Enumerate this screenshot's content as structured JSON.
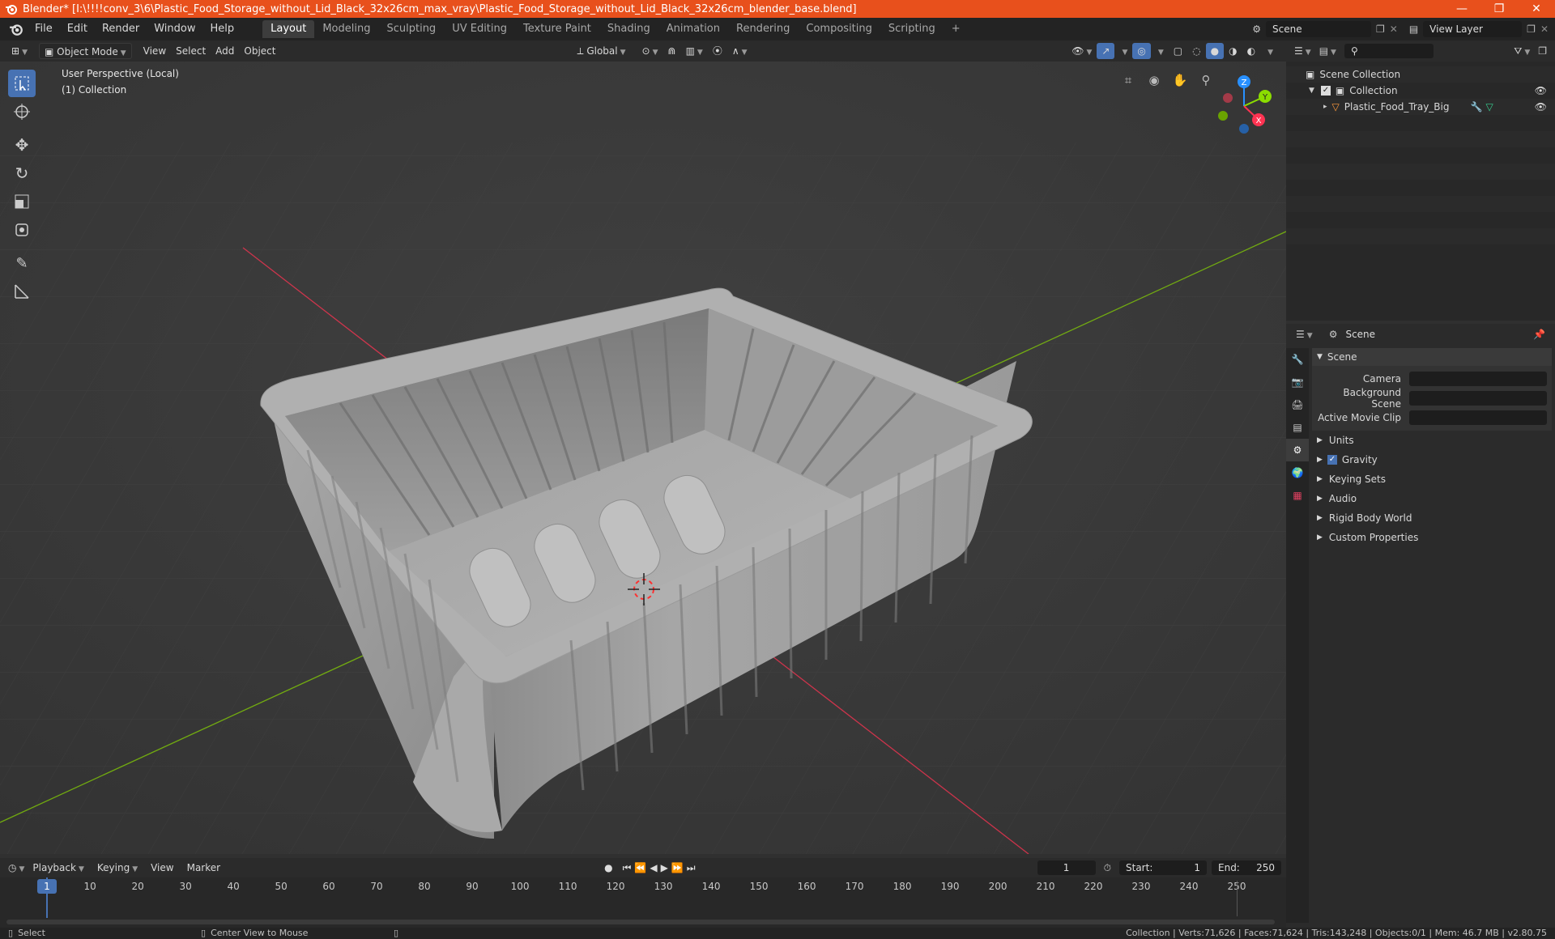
{
  "window": {
    "title": "Blender* [I:\\!!!!conv_3\\6\\Plastic_Food_Storage_without_Lid_Black_32x26cm_max_vray\\Plastic_Food_Storage_without_Lid_Black_32x26cm_blender_base.blend]",
    "minimize": "—",
    "maximize": "❐",
    "close": "✕"
  },
  "menu": [
    "File",
    "Edit",
    "Render",
    "Window",
    "Help"
  ],
  "workspaces": [
    "Layout",
    "Modeling",
    "Sculpting",
    "UV Editing",
    "Texture Paint",
    "Shading",
    "Animation",
    "Rendering",
    "Compositing",
    "Scripting"
  ],
  "workspace_add": "+",
  "scene_name": "Scene",
  "view_layer": "View Layer",
  "viewport_header": {
    "mode": "Object Mode",
    "menus": [
      "View",
      "Select",
      "Add",
      "Object"
    ],
    "orientation": "Global"
  },
  "viewport": {
    "perspective": "User Perspective (Local)",
    "collection": "(1) Collection",
    "gizmo": {
      "x": "X",
      "y": "Y",
      "z": "Z"
    }
  },
  "outliner": {
    "root": "Scene Collection",
    "collection": "Collection",
    "object": "Plastic_Food_Tray_Big"
  },
  "properties": {
    "context": "Scene",
    "panel": "Scene",
    "fields": [
      {
        "label": "Camera",
        "value": ""
      },
      {
        "label": "Background Scene",
        "value": ""
      },
      {
        "label": "Active Movie Clip",
        "value": ""
      }
    ],
    "sections": [
      "Units",
      "Gravity",
      "Keying Sets",
      "Audio",
      "Rigid Body World",
      "Custom Properties"
    ]
  },
  "timeline": {
    "menus": [
      "Playback",
      "Keying",
      "View",
      "Marker"
    ],
    "current_frame": "1",
    "start_label": "Start:",
    "start": "1",
    "end_label": "End:",
    "end": "250",
    "ticks": [
      "10",
      "20",
      "30",
      "40",
      "50",
      "60",
      "70",
      "80",
      "90",
      "100",
      "110",
      "120",
      "130",
      "140",
      "150",
      "160",
      "170",
      "180",
      "190",
      "200",
      "210",
      "220",
      "230",
      "240",
      "250"
    ],
    "playhead": "1"
  },
  "status": {
    "left": "Select",
    "middle": "Center View to Mouse",
    "right": "Collection | Verts:71,626 | Faces:71,624 | Tris:143,248 | Objects:0/1 | Mem: 46.7 MB | v2.80.75"
  },
  "colors": {
    "accent": "#4772b3",
    "title_bar": "#e8501c",
    "x_axis": "#ff3352",
    "y_axis": "#8bdc00",
    "z_axis": "#2890ff"
  }
}
